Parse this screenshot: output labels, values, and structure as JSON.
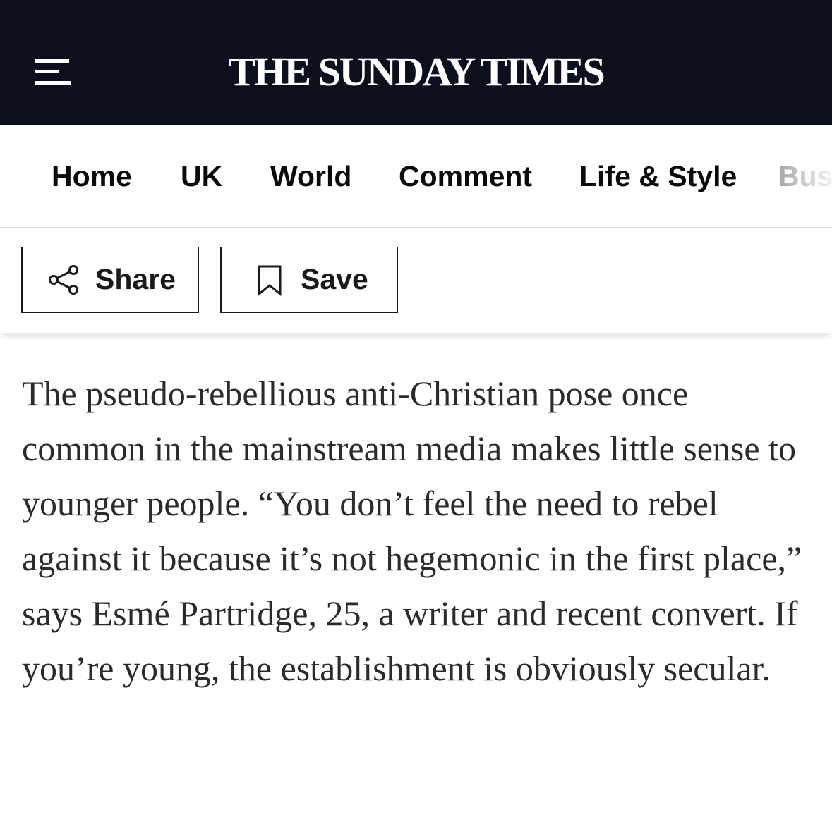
{
  "header": {
    "menu_icon": "hamburger-menu-icon",
    "logo_text": "THE SUNDAY TIMES",
    "background_color": "#0c0f1e"
  },
  "nav": {
    "items": [
      {
        "label": "Home"
      },
      {
        "label": "UK"
      },
      {
        "label": "World"
      },
      {
        "label": "Comment"
      },
      {
        "label": "Life & Style"
      },
      {
        "label": "Bus"
      }
    ]
  },
  "toolbar": {
    "share_label": "Share",
    "share_icon": "share-icon",
    "save_label": "Save",
    "save_icon": "bookmark-icon"
  },
  "article": {
    "paragraph": "The pseudo-rebellious anti-Christian pose once common in the mainstream media makes little sense to younger people. “You don’t feel the need to rebel against it because it’s not hegemonic in the first place,” says Esmé Partridge, 25, a writer and recent convert. If you’re young, the establishment is obviously secular."
  }
}
